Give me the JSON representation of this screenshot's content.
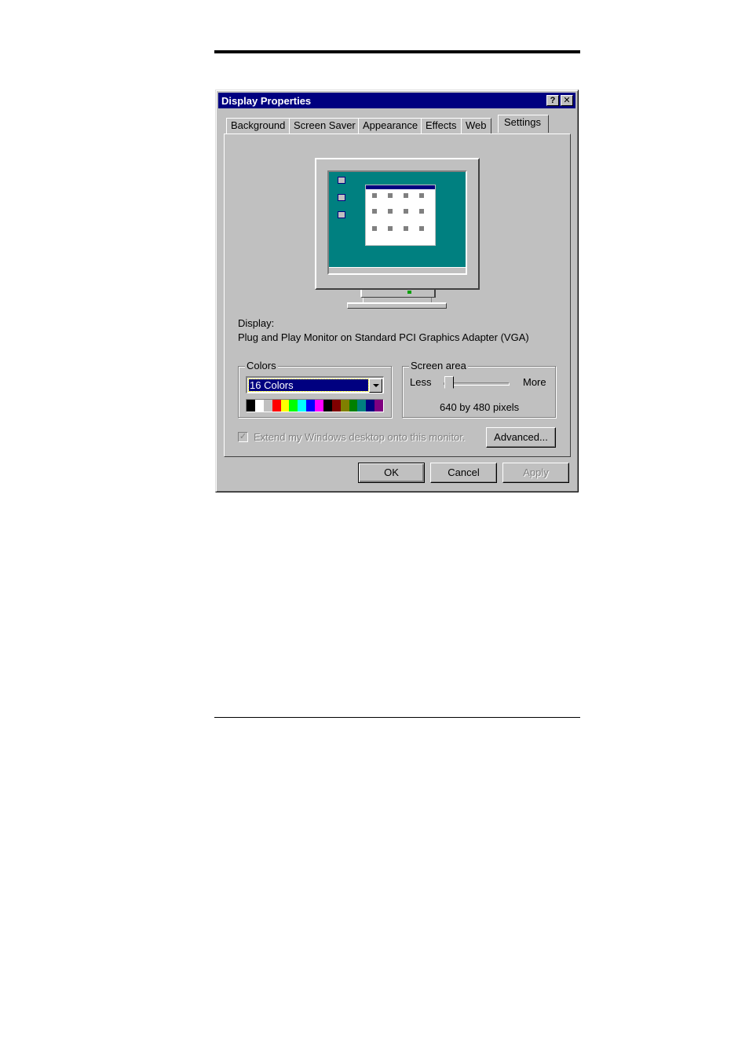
{
  "window": {
    "title": "Display Properties",
    "help_glyph": "?",
    "close_glyph": "✕"
  },
  "tabs": [
    {
      "label": "Background"
    },
    {
      "label": "Screen Saver"
    },
    {
      "label": "Appearance"
    },
    {
      "label": "Effects"
    },
    {
      "label": "Web"
    },
    {
      "label": "Settings"
    }
  ],
  "active_tab": "Settings",
  "display": {
    "label": "Display:",
    "value": "Plug and Play Monitor on Standard PCI Graphics Adapter (VGA)"
  },
  "colors": {
    "group_label": "Colors",
    "selected": "16 Colors",
    "palette": [
      "#000000",
      "#ffffff",
      "#c0c0c0",
      "#ff0000",
      "#ffff00",
      "#00ff00",
      "#00ffff",
      "#0000ff",
      "#ff00ff",
      "#000000",
      "#800000",
      "#808000",
      "#008000",
      "#008080",
      "#000080",
      "#800080"
    ]
  },
  "screen_area": {
    "group_label": "Screen area",
    "less_label": "Less",
    "more_label": "More",
    "resolution": "640 by 480 pixels",
    "slider_level": 0
  },
  "extend_desktop": {
    "label": "Extend my Windows desktop onto this monitor.",
    "check_glyph": "✓",
    "checked": true,
    "enabled": false
  },
  "buttons": {
    "advanced": "Advanced...",
    "ok": "OK",
    "cancel": "Cancel",
    "apply": "Apply"
  }
}
